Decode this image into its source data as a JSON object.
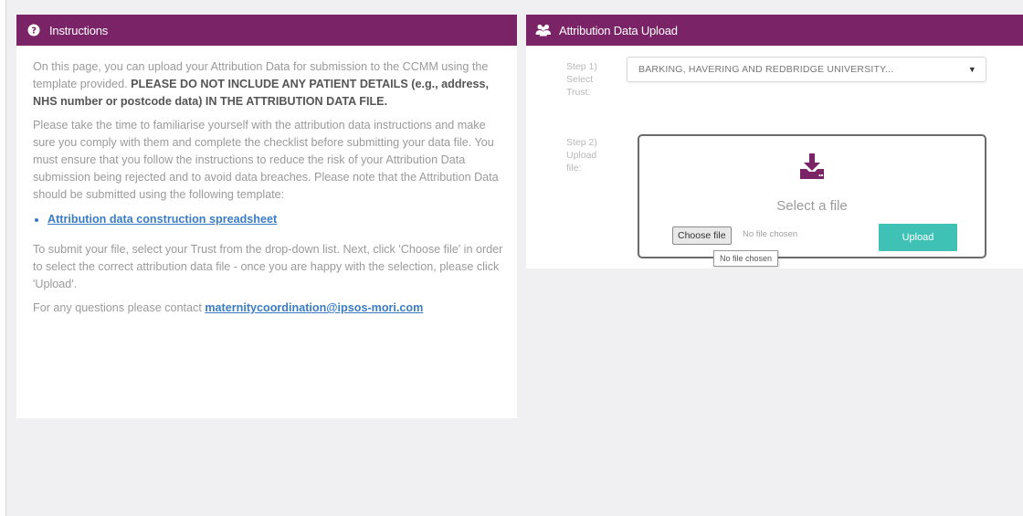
{
  "instructions": {
    "title": "Instructions",
    "p1_text": "On this page, you can upload your Attribution Data for submission to the CCMM using the template provided. ",
    "p1_bold": "PLEASE DO NOT INCLUDE ANY PATIENT DETAILS (e.g., address, NHS number or postcode data) IN THE ATTRIBUTION DATA FILE.",
    "p2": "Please take the time to familiarise yourself with the attribution data instructions and make sure you comply with them and complete the checklist before submitting your data file. You must ensure that you follow the instructions to reduce the risk of your Attribution Data submission being rejected and to avoid data breaches. Please note that the Attribution Data should be submitted using the following template:",
    "link_spreadsheet": "Attribution data construction spreadsheet",
    "p3": "To submit your file, select your Trust from the drop-down list. Next, click 'Choose file' in order to select the correct attribution data file - once you are happy with the selection, please click 'Upload'.",
    "p4_text": "For any questions please contact ",
    "p4_email": "maternitycoordination@ipsos-mori.com"
  },
  "upload": {
    "title": "Attribution Data Upload",
    "step1_label": "Step 1) Select Trust:",
    "trust_selected": "BARKING, HAVERING AND REDBRIDGE UNIVERSITY...",
    "step2_label": "Step 2) Upload file:",
    "dropzone_text": "Select a file",
    "choose_file_label": "Choose file",
    "no_file_text": "No file chosen",
    "upload_button": "Upload",
    "tooltip": "No file chosen"
  },
  "colors": {
    "header": "#7a2367",
    "upload_button": "#3fc2b5",
    "link": "#3a7cc4"
  },
  "icons": {
    "instructions": "question-circle-icon",
    "upload_header": "users-icon",
    "dropzone": "download-tray-icon",
    "select": "caret-down-icon"
  }
}
